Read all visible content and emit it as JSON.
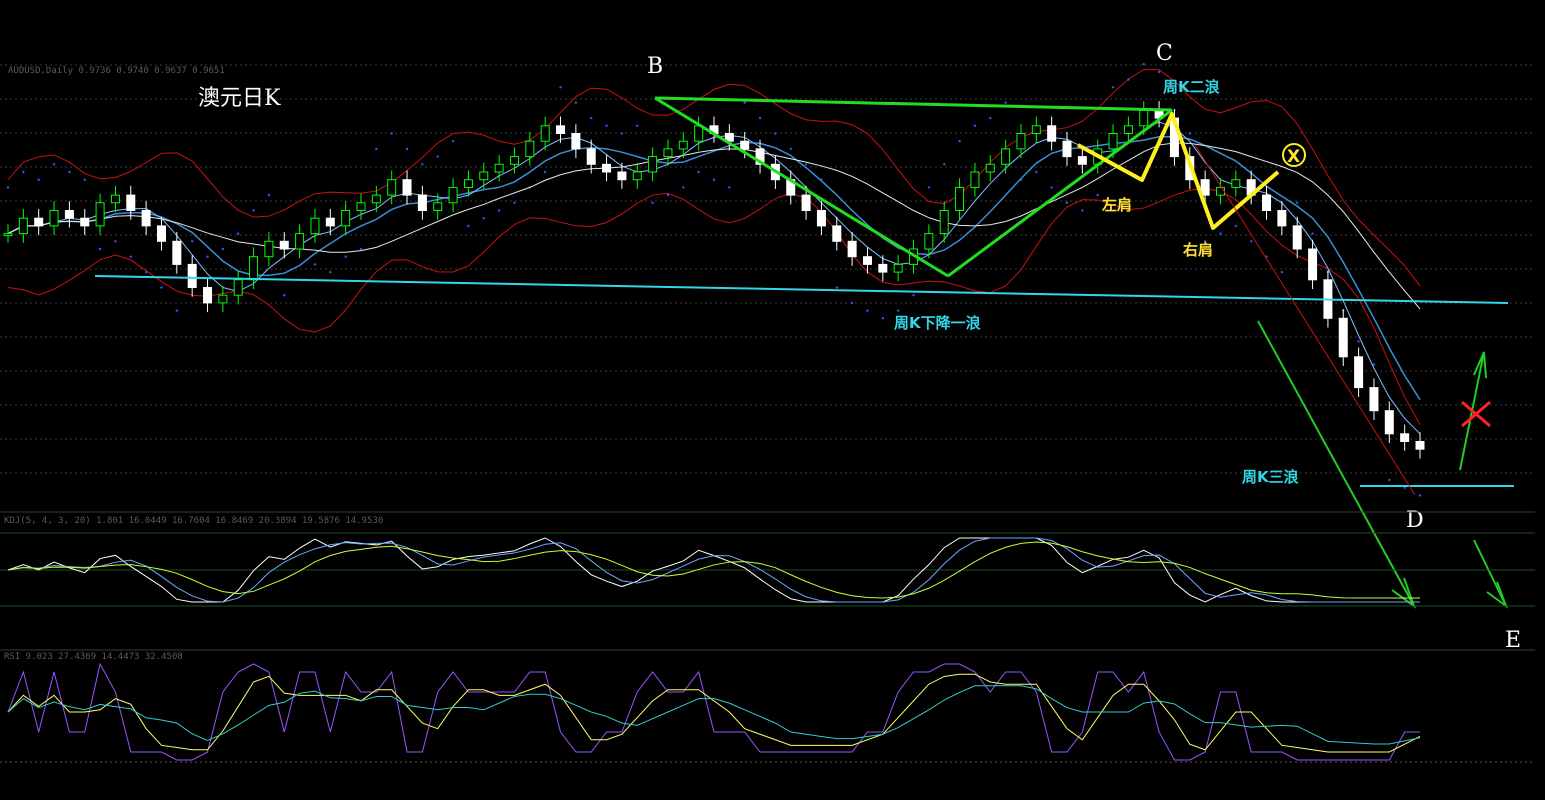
{
  "chart_data": {
    "type": "candlestick",
    "title": "澳元日K",
    "info_line": "AUDUSD,Daily  0.9736 0.9740 0.9637 0.9651",
    "osc1_info": "KDJ(5, 4, 3, 20) 1.801 16.0449 16.7604 16.8469 20.3894 19.5876 14.9530",
    "osc2_info": "RSI 9.023 27.4369 14.4473 32.4508",
    "colors": {
      "up": "#00ff00",
      "down": "#ffffff",
      "bollinger": "#cc1111",
      "ma_blue": "#3a8fd8",
      "ma_white": "#e8e8e8",
      "psar": "#3355ff",
      "pattern": "#22dd22",
      "shoulder": "#ffee22",
      "support": "#33d6e6",
      "grid": "#1e4d1e"
    },
    "markers": {
      "B": "B",
      "C": "C",
      "D": "D",
      "E": "E",
      "X": "X"
    },
    "annotations": {
      "wave1": "周K下降一浪",
      "wave2": "周K二浪",
      "wave3": "周K三浪",
      "left_shoulder": "左肩",
      "right_shoulder": "右肩"
    },
    "price_close_index": [
      0.95,
      0.96,
      0.955,
      0.965,
      0.96,
      0.955,
      0.97,
      0.975,
      0.965,
      0.955,
      0.945,
      0.93,
      0.915,
      0.905,
      0.91,
      0.92,
      0.935,
      0.945,
      0.94,
      0.95,
      0.96,
      0.955,
      0.965,
      0.97,
      0.975,
      0.985,
      0.975,
      0.965,
      0.97,
      0.98,
      0.985,
      0.99,
      0.995,
      1.0,
      1.01,
      1.02,
      1.015,
      1.005,
      0.995,
      0.99,
      0.985,
      0.99,
      1.0,
      1.005,
      1.01,
      1.02,
      1.015,
      1.01,
      1.005,
      0.995,
      0.985,
      0.975,
      0.965,
      0.955,
      0.945,
      0.935,
      0.93,
      0.925,
      0.93,
      0.94,
      0.95,
      0.965,
      0.98,
      0.99,
      0.995,
      1.005,
      1.015,
      1.02,
      1.01,
      1.0,
      0.995,
      1.005,
      1.015,
      1.02,
      1.03,
      1.025,
      1.0,
      0.985,
      0.975,
      0.98,
      0.985,
      0.975,
      0.965,
      0.955,
      0.94,
      0.92,
      0.895,
      0.87,
      0.85,
      0.835,
      0.82,
      0.815,
      0.81
    ]
  }
}
